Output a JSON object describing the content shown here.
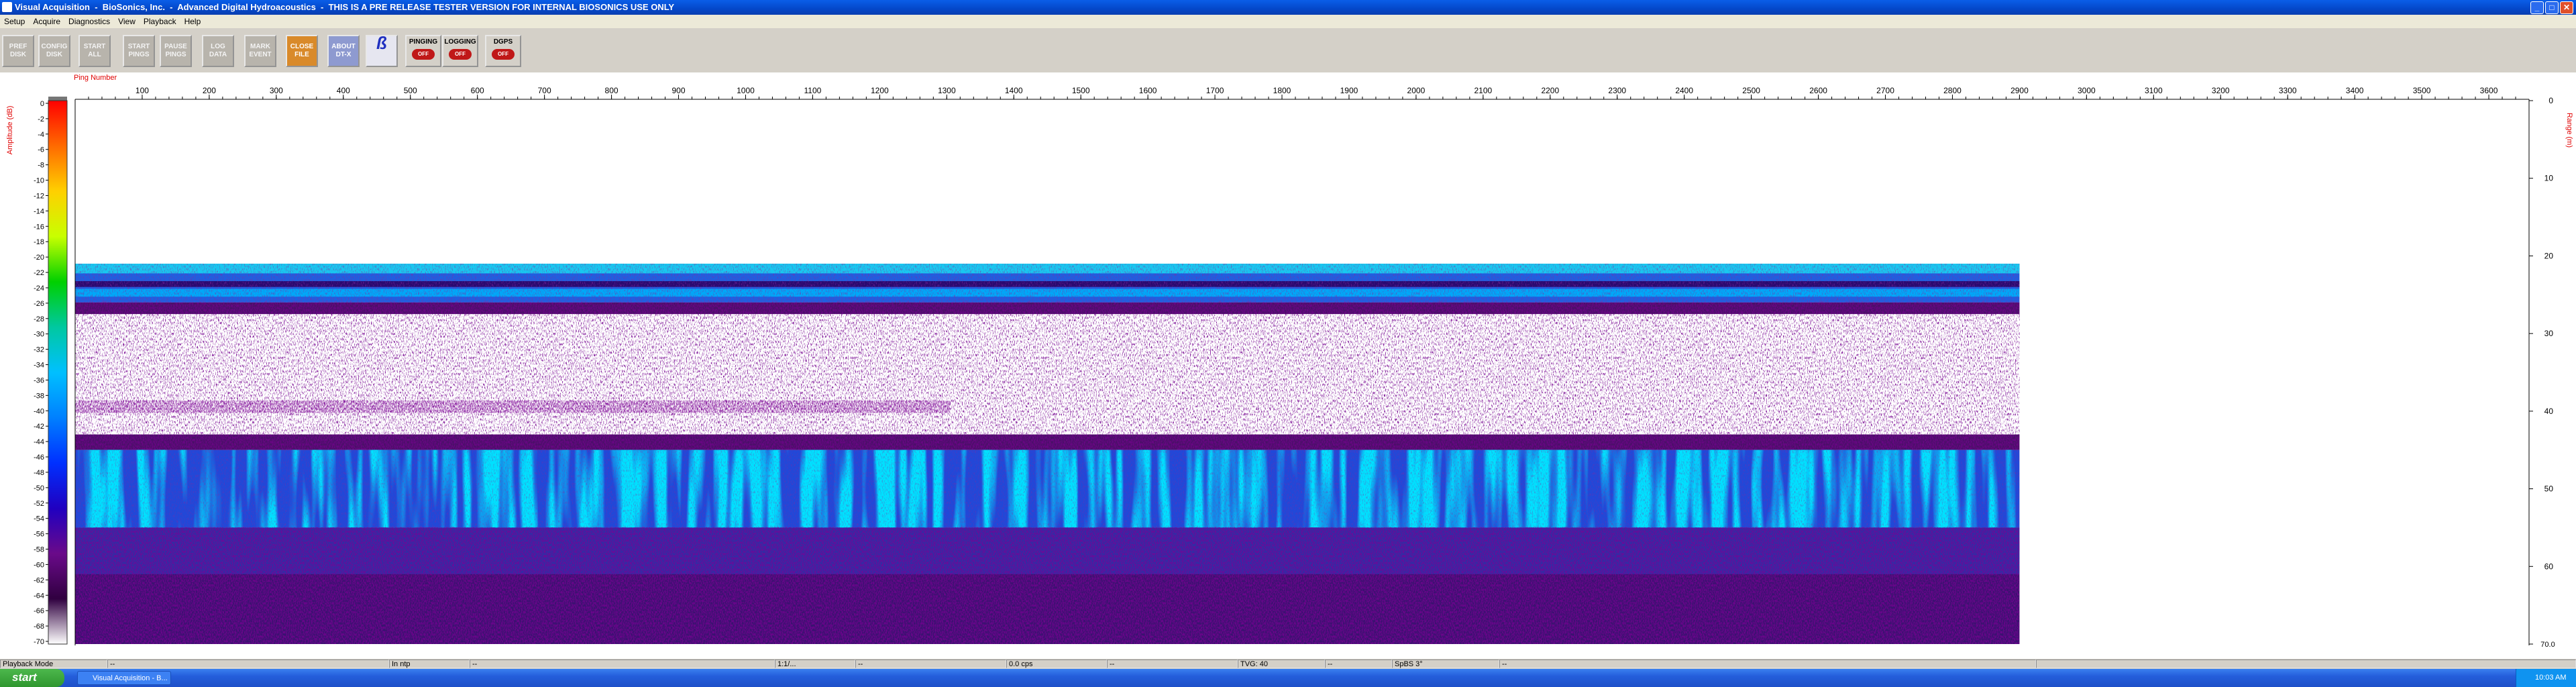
{
  "window": {
    "title": "Visual Acquisition  -  BioSonics, Inc.  -  Advanced Digital Hydroacoustics  -  THIS IS A PRE RELEASE TESTER VERSION FOR INTERNAL BIOSONICS USE ONLY"
  },
  "menu": [
    "Setup",
    "Acquire",
    "Diagnostics",
    "View",
    "Playback",
    "Help"
  ],
  "toolbar": {
    "buttons": [
      {
        "label": "PREF\nDISK",
        "style": "gray"
      },
      {
        "label": "CONFIG\nDISK",
        "style": "gray"
      },
      {
        "label": "START\nALL",
        "style": "gray"
      },
      {
        "label": "START\nPINGS",
        "style": "gray"
      },
      {
        "label": "PAUSE\nPINGS",
        "style": "gray"
      },
      {
        "label": "LOG\nDATA",
        "style": "gray"
      },
      {
        "label": "MARK\nEVENT",
        "style": "gray"
      },
      {
        "label": "CLOSE\nFILE",
        "style": "orange"
      },
      {
        "label": "ABOUT\nDT-X",
        "style": "blue"
      }
    ],
    "toggles": [
      {
        "label": "PINGING",
        "state": "OFF"
      },
      {
        "label": "LOGGING",
        "state": "OFF"
      },
      {
        "label": "DGPS",
        "state": "OFF"
      }
    ]
  },
  "echogram": {
    "x_axis_title": "Ping Number",
    "x_ticks": [
      100,
      200,
      300,
      400,
      500,
      600,
      700,
      800,
      900,
      1000,
      1100,
      1200,
      1300,
      1400,
      1500,
      1600,
      1700,
      1800,
      1900,
      2000,
      2100,
      2200,
      2300,
      2400,
      2500,
      2600,
      2700,
      2800,
      2900,
      3000,
      3100,
      3200,
      3300,
      3400,
      3500,
      3600
    ],
    "x_max": 3660,
    "data_last_ping": 2900,
    "amplitude_title": "Amplitude (dB)",
    "amplitude_ticks": [
      "0",
      "-2",
      "-4",
      "-6",
      "-8",
      "-10",
      "-12",
      "-14",
      "-16",
      "-18",
      "-20",
      "-22",
      "-24",
      "-26",
      "-28",
      "-30",
      "-32",
      "-34",
      "-36",
      "-38",
      "-40",
      "-42",
      "-44",
      "-46",
      "-48",
      "-50",
      "-52",
      "-54",
      "-56",
      "-58",
      "-60",
      "-62",
      "-64",
      "-66",
      "-68",
      "-70"
    ],
    "range_title": "Range (m)",
    "range_ticks": [
      0,
      10,
      20,
      30,
      40,
      50,
      60,
      70
    ],
    "range_max": 70,
    "range_last_label": "70.0",
    "data_top_range": 21,
    "layers": [
      {
        "from": 21,
        "to": 26,
        "kind": "surface-blue"
      },
      {
        "from": 26,
        "to": 27.5,
        "kind": "purple"
      },
      {
        "from": 27.5,
        "to": 43,
        "kind": "speckle-white"
      },
      {
        "from": 43,
        "to": 45,
        "kind": "purple"
      },
      {
        "from": 45,
        "to": 55,
        "kind": "bottom-blue"
      },
      {
        "from": 55,
        "to": 70,
        "kind": "deep-purple"
      }
    ],
    "colors": {
      "scale": [
        "#ff0000",
        "#ff6a00",
        "#ffd000",
        "#c8ff00",
        "#00d000",
        "#00c8a0",
        "#00c0ff",
        "#0080ff",
        "#0030ff",
        "#2000c0",
        "#6a0a8a",
        "#300040",
        "#ffffff"
      ],
      "axis_label": "#e00000"
    }
  },
  "status": {
    "mode": "Playback Mode",
    "c1a": "--",
    "c2": "In ntp",
    "c2b": "--",
    "c3": "1:1/...",
    "c3b": "--",
    "c4": "0.0 cps",
    "c4b": "--",
    "c5": "TVG: 40",
    "c5b": "--",
    "c6": "SpBS 3°",
    "c6b": "--"
  },
  "taskbar": {
    "start": "start",
    "item": "Visual Acquisition - B...",
    "clock": "10:03 AM"
  }
}
